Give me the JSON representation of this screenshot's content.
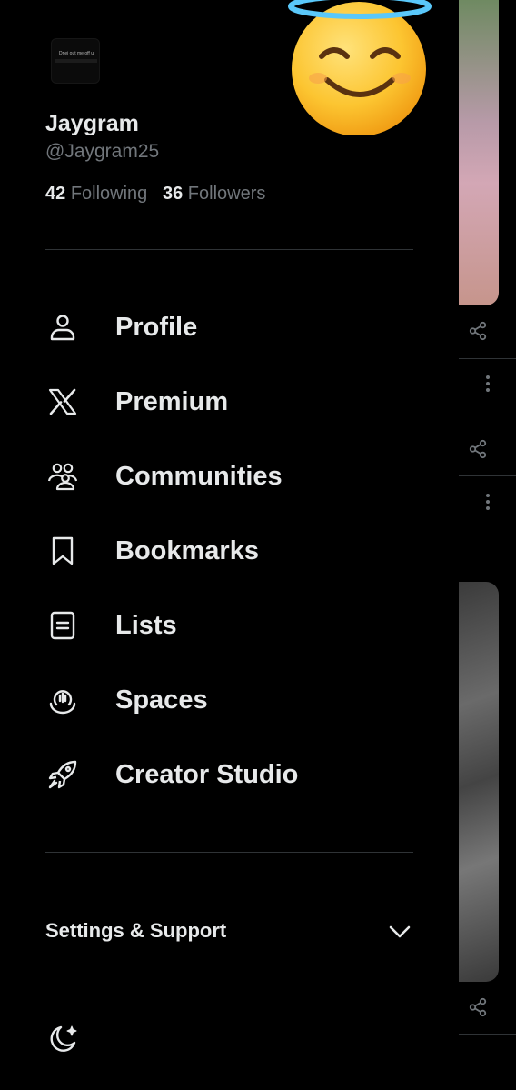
{
  "user": {
    "name": "Jaygram",
    "handle": "@Jaygram25",
    "avatar_caption": "Dnei out me off u"
  },
  "stats": {
    "following_count": "42",
    "following_label": "Following",
    "followers_count": "36",
    "followers_label": "Followers"
  },
  "nav": {
    "items": [
      {
        "label": "Profile",
        "icon": "person-icon"
      },
      {
        "label": "Premium",
        "icon": "x-logo-icon"
      },
      {
        "label": "Communities",
        "icon": "communities-icon"
      },
      {
        "label": "Bookmarks",
        "icon": "bookmark-icon"
      },
      {
        "label": "Lists",
        "icon": "list-icon"
      },
      {
        "label": "Spaces",
        "icon": "spaces-icon"
      },
      {
        "label": "Creator Studio",
        "icon": "rocket-icon"
      }
    ]
  },
  "settings": {
    "label": "Settings & Support"
  },
  "colors": {
    "background": "#000000",
    "text_primary": "#e7e9ea",
    "text_secondary": "#71767b",
    "divider": "#2f3336"
  }
}
